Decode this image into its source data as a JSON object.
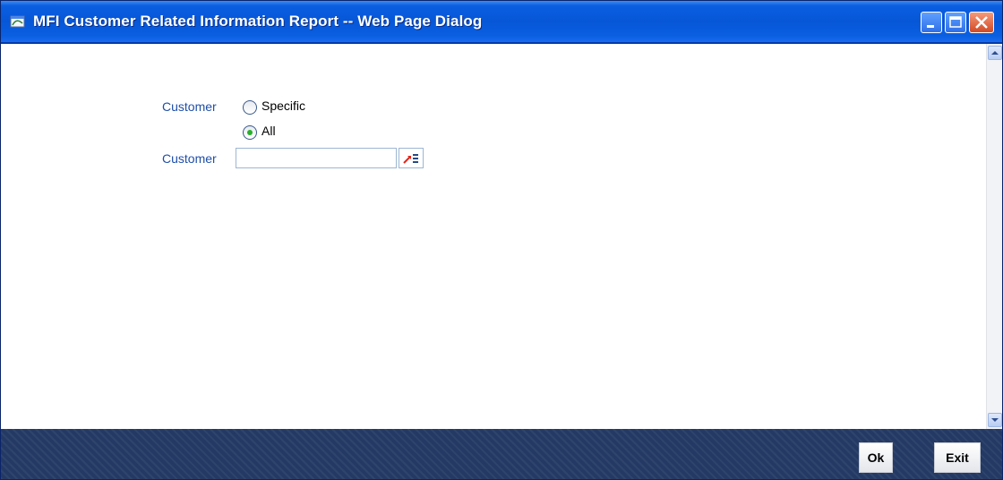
{
  "window": {
    "title": "MFI Customer Related Information Report -- Web Page Dialog"
  },
  "form": {
    "customer_label": "Customer",
    "radio_specific_label": "Specific",
    "radio_all_label": "All",
    "selected_option": "All",
    "customer_field_label": "Customer",
    "customer_field_value": ""
  },
  "buttons": {
    "ok": "Ok",
    "exit": "Exit"
  },
  "icons": {
    "title": "ie-page-icon",
    "minimize": "minimize-icon",
    "maximize": "maximize-icon",
    "close": "close-icon",
    "lov": "list-of-values-icon",
    "scroll_up": "scroll-up-arrow-icon",
    "scroll_down": "scroll-down-arrow-icon"
  },
  "colors": {
    "titlebar": "#0756d8",
    "label": "#1f4fa8",
    "footer": "#243a64",
    "radio_selected": "#27b02a"
  }
}
